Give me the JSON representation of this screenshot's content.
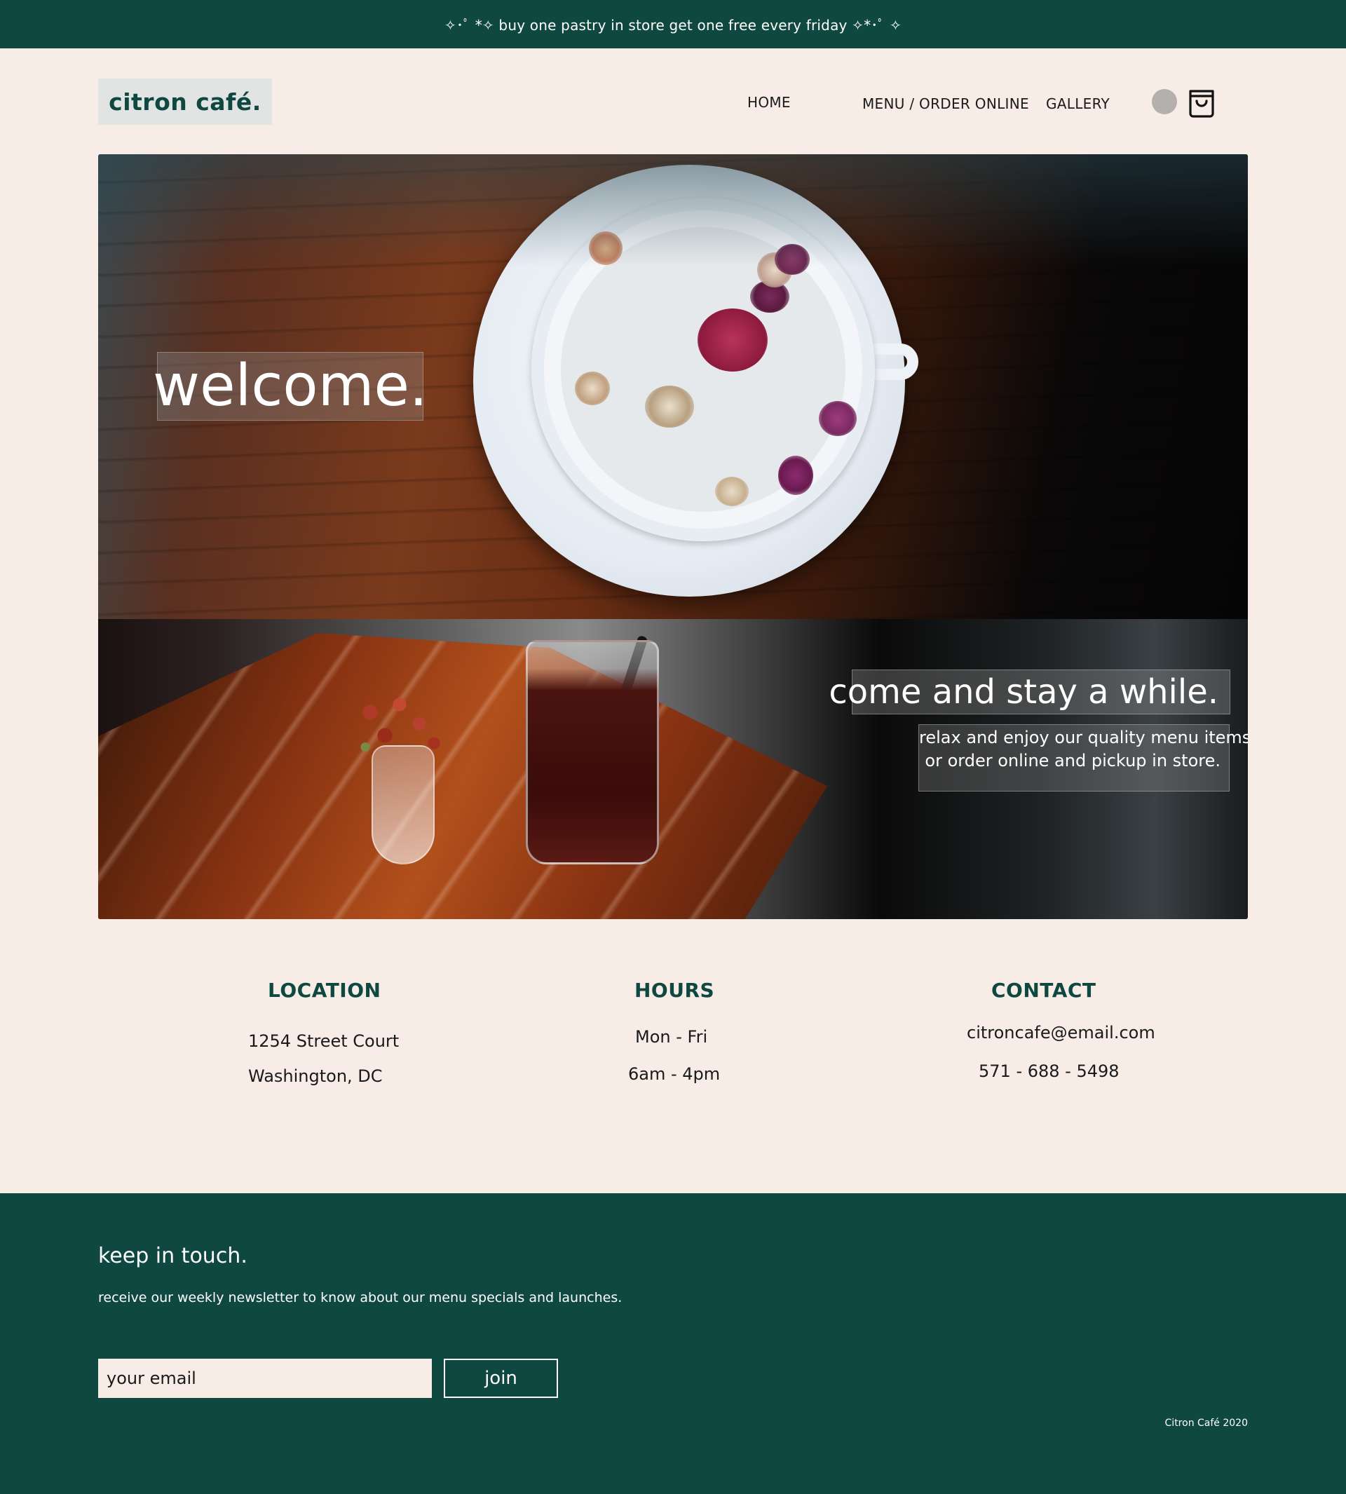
{
  "promo": {
    "text": "✧･ﾟ *✧ buy one pastry in store get one free every friday ✧*･ﾟ ✧"
  },
  "header": {
    "logo": "citron café.",
    "nav": {
      "home": "HOME",
      "menu": "MENU / ORDER ONLINE",
      "gallery": "GALLERY"
    },
    "icons": {
      "account": "user-avatar-icon",
      "cart": "shopping-bag-icon"
    }
  },
  "hero": {
    "welcome": "welcome.",
    "stay_title": "come and stay a while.",
    "stay_sub_line1": "relax and enjoy our quality menu items",
    "stay_sub_line2": "or order online and pickup in store."
  },
  "info": {
    "location": {
      "heading": "LOCATION",
      "line1": "1254 Street Court",
      "line2": "Washington, DC"
    },
    "hours": {
      "heading": "HOURS",
      "line1": "Mon - Fri",
      "line2": "6am - 4pm"
    },
    "contact": {
      "heading": "CONTACT",
      "email": "citroncafe@email.com",
      "phone": "571 - 688 - 5498"
    }
  },
  "footer": {
    "title": "keep in touch.",
    "subtitle": "receive our weekly newsletter to know about our menu specials and launches.",
    "email_placeholder": "your email",
    "join_label": "join",
    "copyright": "Citron Café 2020"
  },
  "colors": {
    "brand_green": "#0f4840",
    "background": "#f7ece6",
    "logo_bg": "#e2e4e4"
  }
}
